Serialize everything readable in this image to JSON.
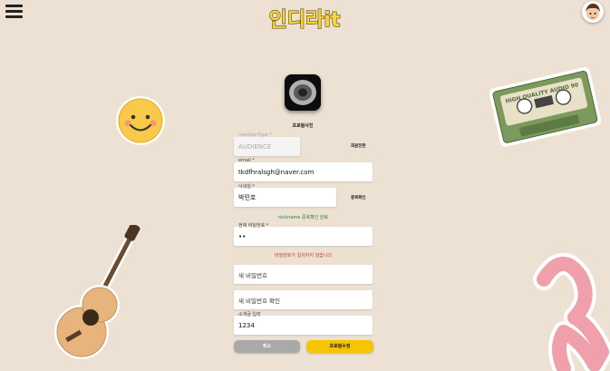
{
  "header": {
    "logo_text": "인디라it"
  },
  "profile": {
    "caption": "프로필사진"
  },
  "form": {
    "member_type": {
      "label": "memberType *",
      "value": "AUDIENCE",
      "side_button": "회원전환"
    },
    "email": {
      "label": "email *",
      "value": "tkdfhralsgh@naver.com"
    },
    "nickname": {
      "label": "닉네임 *",
      "value": "박민호",
      "side_button": "중복확인",
      "status_message": "nickname 중복확인 완료"
    },
    "current_password": {
      "label": "현재 비밀번호 *",
      "value": "••",
      "error_message": "비밀번호가 일치하지 않습니다"
    },
    "new_password": {
      "placeholder": "새 비밀번호"
    },
    "confirm_password": {
      "placeholder": "새 비밀번호 확인"
    },
    "intro": {
      "label": "소개글 입력",
      "value": "1234"
    },
    "cancel_button": "취소",
    "submit_button": "프로필수정"
  },
  "colors": {
    "background": "#ece1d3",
    "status_ok": "#2e7d32",
    "status_error": "#d32f2f",
    "submit_button": "#f7c400",
    "cancel_button": "#a9a9a9",
    "logo_fill": "#f8d53a"
  },
  "decorations": {
    "cassette_text": "HIGH QUALITY AUDIO 90"
  }
}
